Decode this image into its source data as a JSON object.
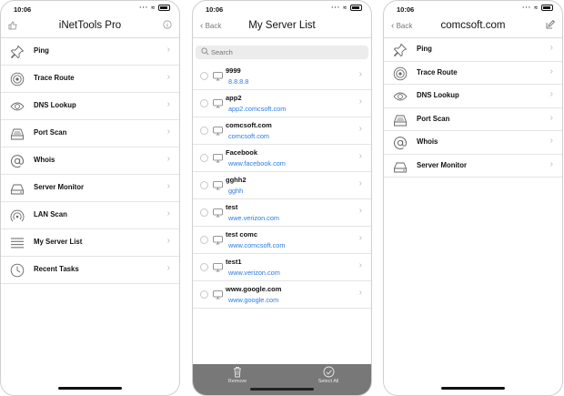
{
  "status_time": "10:06",
  "screen1": {
    "title": "iNetTools Pro",
    "menu": [
      {
        "label": "Ping",
        "icon": "pin-icon"
      },
      {
        "label": "Trace Route",
        "icon": "trace-route-icon"
      },
      {
        "label": "DNS Lookup",
        "icon": "eye-icon"
      },
      {
        "label": "Port Scan",
        "icon": "port-scan-icon"
      },
      {
        "label": "Whois",
        "icon": "at-sign-icon"
      },
      {
        "label": "Server Monitor",
        "icon": "server-monitor-icon"
      },
      {
        "label": "LAN Scan",
        "icon": "lan-scan-icon"
      },
      {
        "label": "My Server List",
        "icon": "list-icon"
      },
      {
        "label": "Recent Tasks",
        "icon": "clock-icon"
      }
    ]
  },
  "screen2": {
    "back_label": "Back",
    "title": "My Server List",
    "search_placeholder": "Search",
    "servers": [
      {
        "name": "9999",
        "address": "8.8.8.8"
      },
      {
        "name": "app2",
        "address": "app2.comcsoft.com"
      },
      {
        "name": "comcsoft.com",
        "address": "comcsoft.com"
      },
      {
        "name": "Facebook",
        "address": "www.facebook.com"
      },
      {
        "name": "gghh2",
        "address": "gghh"
      },
      {
        "name": "test",
        "address": "wwe.verizon.com"
      },
      {
        "name": "test comc",
        "address": "www.comcsoft.com"
      },
      {
        "name": "test1",
        "address": "www.verizon.com"
      },
      {
        "name": "www.google.com",
        "address": "www.google.com"
      }
    ],
    "toolbar": {
      "remove_label": "Remove",
      "select_all_label": "Select All"
    }
  },
  "screen3": {
    "back_label": "Back",
    "title": "comcsoft.com",
    "menu": [
      {
        "label": "Ping",
        "icon": "pin-icon"
      },
      {
        "label": "Trace Route",
        "icon": "trace-route-icon"
      },
      {
        "label": "DNS Lookup",
        "icon": "eye-icon"
      },
      {
        "label": "Port Scan",
        "icon": "port-scan-icon"
      },
      {
        "label": "Whois",
        "icon": "at-sign-icon"
      },
      {
        "label": "Server Monitor",
        "icon": "server-monitor-icon"
      }
    ]
  },
  "colors": {
    "link": "#2a7be4",
    "toolbar": "#787878"
  }
}
